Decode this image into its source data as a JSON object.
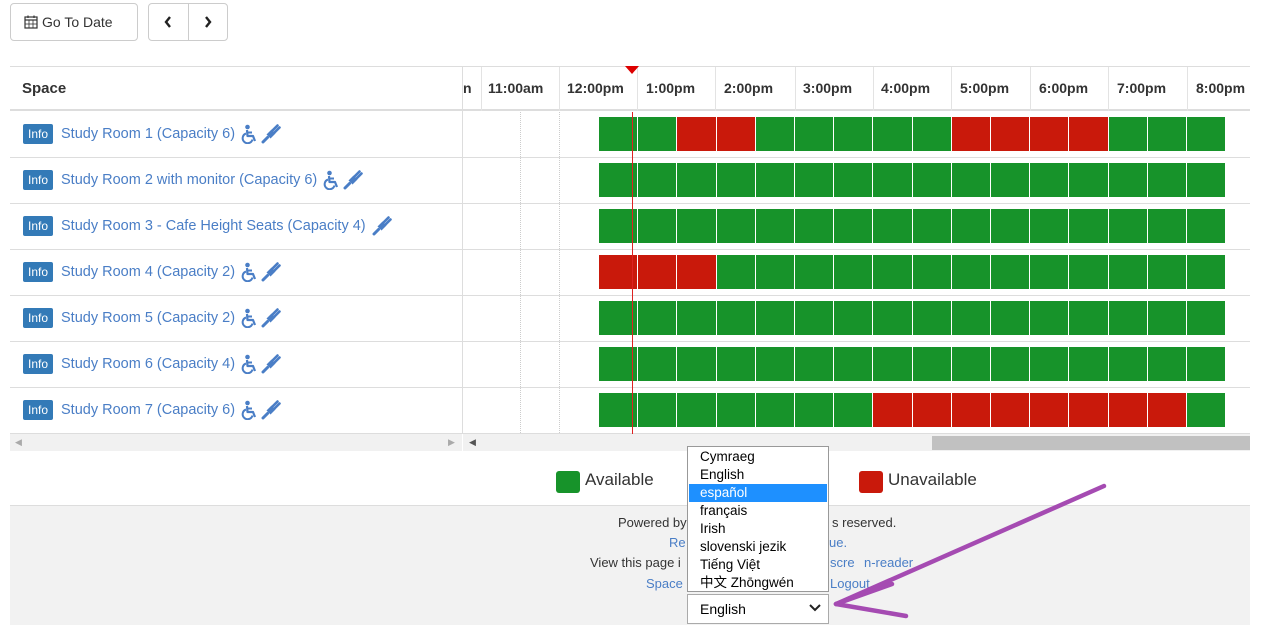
{
  "toolbar": {
    "go_to_date_label": "Go To Date",
    "prev_icon": "chevron-left-icon",
    "next_icon": "chevron-right-icon"
  },
  "grid": {
    "space_header": "Space",
    "hours": [
      "n",
      "11:00am",
      "12:00pm",
      "1:00pm",
      "2:00pm",
      "3:00pm",
      "4:00pm",
      "5:00pm",
      "6:00pm",
      "7:00pm",
      "8:00pm"
    ],
    "slot_start_label": "12:30pm",
    "slot_minutes": 30,
    "rooms": [
      {
        "info": "Info",
        "name": "Study Room 1 (Capacity 6)",
        "accessible": true,
        "power": true,
        "slots": [
          "A",
          "A",
          "U",
          "U",
          "A",
          "A",
          "A",
          "A",
          "A",
          "U",
          "U",
          "U",
          "U",
          "A",
          "A",
          "A"
        ]
      },
      {
        "info": "Info",
        "name": "Study Room 2 with monitor (Capacity 6)",
        "accessible": true,
        "power": true,
        "slots": [
          "A",
          "A",
          "A",
          "A",
          "A",
          "A",
          "A",
          "A",
          "A",
          "A",
          "A",
          "A",
          "A",
          "A",
          "A",
          "A"
        ]
      },
      {
        "info": "Info",
        "name": "Study Room 3 - Cafe Height Seats (Capacity 4)",
        "accessible": false,
        "power": true,
        "slots": [
          "A",
          "A",
          "A",
          "A",
          "A",
          "A",
          "A",
          "A",
          "A",
          "A",
          "A",
          "A",
          "A",
          "A",
          "A",
          "A"
        ]
      },
      {
        "info": "Info",
        "name": "Study Room 4 (Capacity 2)",
        "accessible": true,
        "power": true,
        "slots": [
          "U",
          "U",
          "U",
          "A",
          "A",
          "A",
          "A",
          "A",
          "A",
          "A",
          "A",
          "A",
          "A",
          "A",
          "A",
          "A"
        ]
      },
      {
        "info": "Info",
        "name": "Study Room 5 (Capacity 2)",
        "accessible": true,
        "power": true,
        "slots": [
          "A",
          "A",
          "A",
          "A",
          "A",
          "A",
          "A",
          "A",
          "A",
          "A",
          "A",
          "A",
          "A",
          "A",
          "A",
          "A"
        ]
      },
      {
        "info": "Info",
        "name": "Study Room 6 (Capacity 4)",
        "accessible": true,
        "power": true,
        "slots": [
          "A",
          "A",
          "A",
          "A",
          "A",
          "A",
          "A",
          "A",
          "A",
          "A",
          "A",
          "A",
          "A",
          "A",
          "A",
          "A"
        ]
      },
      {
        "info": "Info",
        "name": "Study Room 7 (Capacity 6)",
        "accessible": true,
        "power": true,
        "slots": [
          "A",
          "A",
          "A",
          "A",
          "A",
          "A",
          "A",
          "U",
          "U",
          "U",
          "U",
          "U",
          "U",
          "U",
          "U",
          "A"
        ]
      }
    ]
  },
  "legend": {
    "available_label": "Available",
    "unavailable_label": "Unavailable",
    "available_color": "#17932a",
    "unavailable_color": "#c9190b"
  },
  "footer": {
    "line1_a": "Powered by",
    "line1_b": "s reserved.",
    "line2_a": "Re",
    "line2_b": "ue.",
    "line3_a": "View this page i",
    "line3_b": "scre",
    "line3_c": "n-reader",
    "line4_a": "Space",
    "line4_b": "Logout"
  },
  "language": {
    "options": [
      "Cymraeg",
      "English",
      "español",
      "français",
      "Irish",
      "slovenski jezik",
      "Tiếng Việt",
      "中文 Zhōngwén"
    ],
    "highlighted": "español",
    "selected": "English"
  }
}
